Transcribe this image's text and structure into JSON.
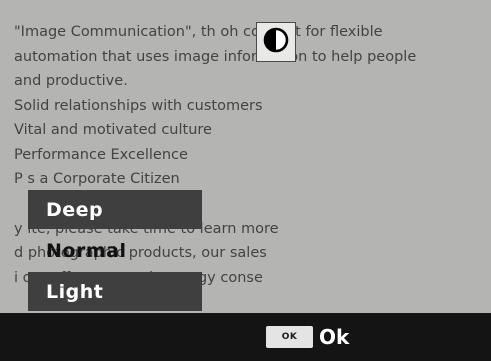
{
  "document": {
    "lines_upper": [
      "\"Image Communication\", th          oh concept for flexible",
      "automation that uses image  information to help people",
      "and productive.",
      "Solid relationships with customers",
      "Vital and motivated culture",
      "Performance Excellence",
      "P                                    s a Corporate Citizen"
    ],
    "lines_lower": [
      "y                         ite, please take time to learn more",
      "d                         photographic products, our sales",
      "i                         our efforts towards energy conse"
    ]
  },
  "contrast_badge": {
    "icon": "contrast-icon"
  },
  "menu": {
    "items": [
      {
        "label": "Deep",
        "state": "unselected"
      },
      {
        "label": "Normal",
        "state": "selected"
      },
      {
        "label": "Light",
        "state": "unselected"
      }
    ]
  },
  "bottom_bar": {
    "ok_key": "OK",
    "ok_label": "Ok"
  },
  "colors": {
    "screen_bg": "#b4b4b2",
    "menu_item_bg": "#3f3f3f",
    "bar_bg": "#141414"
  }
}
